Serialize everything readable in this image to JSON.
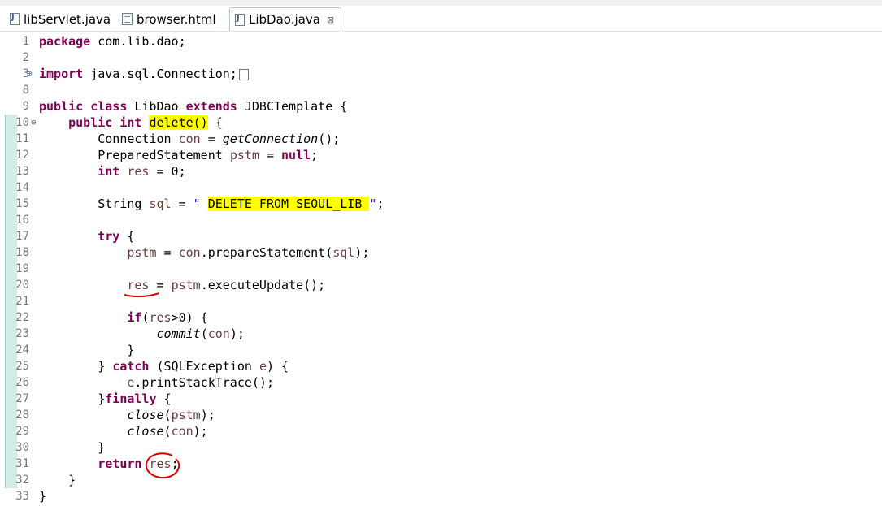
{
  "tabs": [
    {
      "label": "libServlet.java",
      "icon": "java-file-icon",
      "active": false
    },
    {
      "label": "browser.html",
      "icon": "html-file-icon",
      "active": false
    },
    {
      "label": "LibDao.java",
      "icon": "java-file-icon",
      "active": true,
      "close": "⊠"
    }
  ],
  "lines": [
    {
      "n": "1",
      "text": "package com.lib.dao;"
    },
    {
      "n": "2",
      "text": ""
    },
    {
      "n": "3",
      "text": "import java.sql.Connection;"
    },
    {
      "n": "8",
      "text": ""
    },
    {
      "n": "9",
      "text": "public class LibDao extends JDBCTemplate {"
    },
    {
      "n": "10",
      "text": "    public int delete() {"
    },
    {
      "n": "11",
      "text": "        Connection con = getConnection();"
    },
    {
      "n": "12",
      "text": "        PreparedStatement pstm = null;"
    },
    {
      "n": "13",
      "text": "        int res = 0;"
    },
    {
      "n": "14",
      "text": ""
    },
    {
      "n": "15",
      "text": "        String sql = \" DELETE FROM SEOUL_LIB \";"
    },
    {
      "n": "16",
      "text": ""
    },
    {
      "n": "17",
      "text": "        try {"
    },
    {
      "n": "18",
      "text": "            pstm = con.prepareStatement(sql);"
    },
    {
      "n": "19",
      "text": ""
    },
    {
      "n": "20",
      "text": "            res = pstm.executeUpdate();"
    },
    {
      "n": "21",
      "text": ""
    },
    {
      "n": "22",
      "text": "            if(res>0) {"
    },
    {
      "n": "23",
      "text": "                commit(con);"
    },
    {
      "n": "24",
      "text": "            }"
    },
    {
      "n": "25",
      "text": "        } catch (SQLException e) {"
    },
    {
      "n": "26",
      "text": "            e.printStackTrace();"
    },
    {
      "n": "27",
      "text": "        }finally {"
    },
    {
      "n": "28",
      "text": "            close(pstm);"
    },
    {
      "n": "29",
      "text": "            close(con);"
    },
    {
      "n": "30",
      "text": "        }"
    },
    {
      "n": "31",
      "text": "        return res;"
    },
    {
      "n": "32",
      "text": "    }"
    },
    {
      "n": "33",
      "text": "}"
    }
  ],
  "colors": {
    "keyword": "#7f0055",
    "field": "#6a3e3e",
    "string": "#2a00ff",
    "highlight": "#ffff00",
    "annotation": "#e00000"
  }
}
